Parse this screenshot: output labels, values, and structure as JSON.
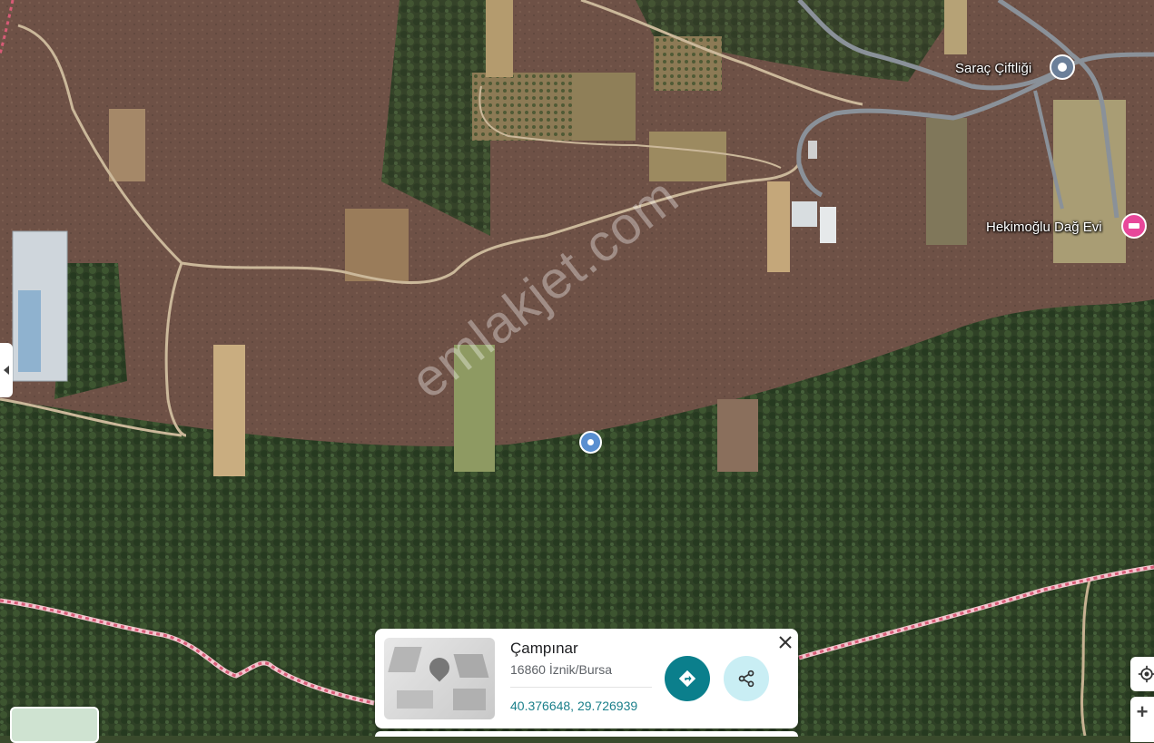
{
  "map": {
    "type": "satellite",
    "watermark": "emlakjet.com",
    "pois": [
      {
        "id": "sarac",
        "label": "Saraç Çiftliği",
        "icon": "place-pin-icon",
        "color": "#6b7f99"
      },
      {
        "id": "hekimoglu",
        "label": "Hekimoğlu Dağ Evi",
        "icon": "hotel-bed-icon",
        "color": "#e8479a"
      }
    ],
    "dropped_pin_icon": "location-pin-icon"
  },
  "place_card": {
    "title": "Çampınar",
    "address": "16860 İznik/Bursa",
    "coordinates": "40.376648, 29.726939",
    "directions_icon": "directions-icon",
    "share_icon": "share-icon",
    "close_icon": "close-icon"
  },
  "controls": {
    "zoom_in": "+",
    "locate_icon": "my-location-icon",
    "collapse_icon": "chevron-left-icon"
  }
}
